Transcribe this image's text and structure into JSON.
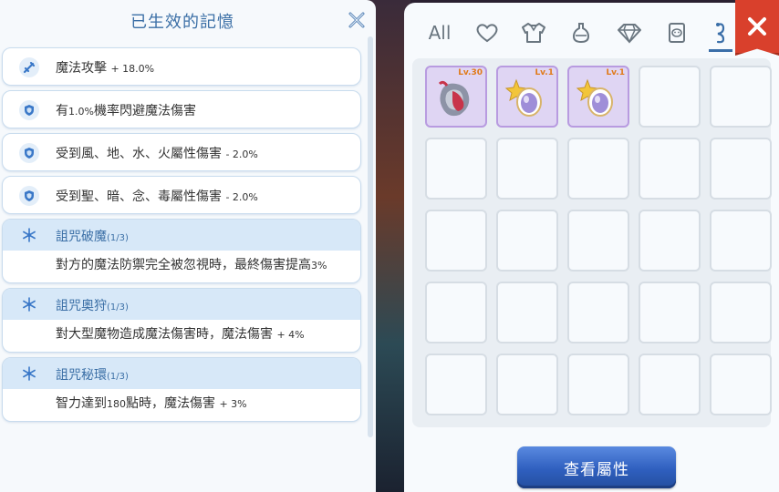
{
  "left": {
    "title": "已生效的記憶",
    "stats": [
      {
        "icon": "sword-icon",
        "text": "魔法攻擊",
        "value": "+ 18.0%"
      },
      {
        "icon": "shield-icon",
        "text": "有",
        "value": "1.0%",
        "text2": "機率閃避魔法傷害"
      },
      {
        "icon": "shield-icon",
        "text": "受到風、地、水、火屬性傷害",
        "value": "- 2.0%"
      },
      {
        "icon": "shield-icon",
        "text": "受到聖、暗、念、毒屬性傷害",
        "value": "- 2.0%"
      }
    ],
    "curses": [
      {
        "name": "詛咒破魔",
        "level": "(1/3)",
        "desc": "對方的魔法防禦完全被忽視時，最終傷害提高",
        "value": "3%"
      },
      {
        "name": "詛咒奧狩",
        "level": "(1/3)",
        "desc": "對大型魔物造成魔法傷害時，魔法傷害",
        "value": "+ 4%"
      },
      {
        "name": "詛咒秘環",
        "level": "(1/3)",
        "desc": "智力達到",
        "value": "180",
        "desc2": "點時，魔法傷害",
        "value2": "+ 3%"
      }
    ]
  },
  "right": {
    "tab_all": "All",
    "tabs": [
      "heart-icon",
      "armor-icon",
      "potion-icon",
      "gem-icon",
      "card-icon",
      "accessory-icon"
    ],
    "active_tab": "accessory-icon",
    "items": [
      {
        "level": "Lv.30",
        "icon": "cursed-mask-icon"
      },
      {
        "level": "Lv.1",
        "icon": "star-crystal-icon"
      },
      {
        "level": "Lv.1",
        "icon": "star-crystal-icon"
      }
    ],
    "button_label": "查看屬性"
  },
  "colors": {
    "accent": "#3b6fa6",
    "close": "#d9402c",
    "button": "#2f5fbf"
  }
}
